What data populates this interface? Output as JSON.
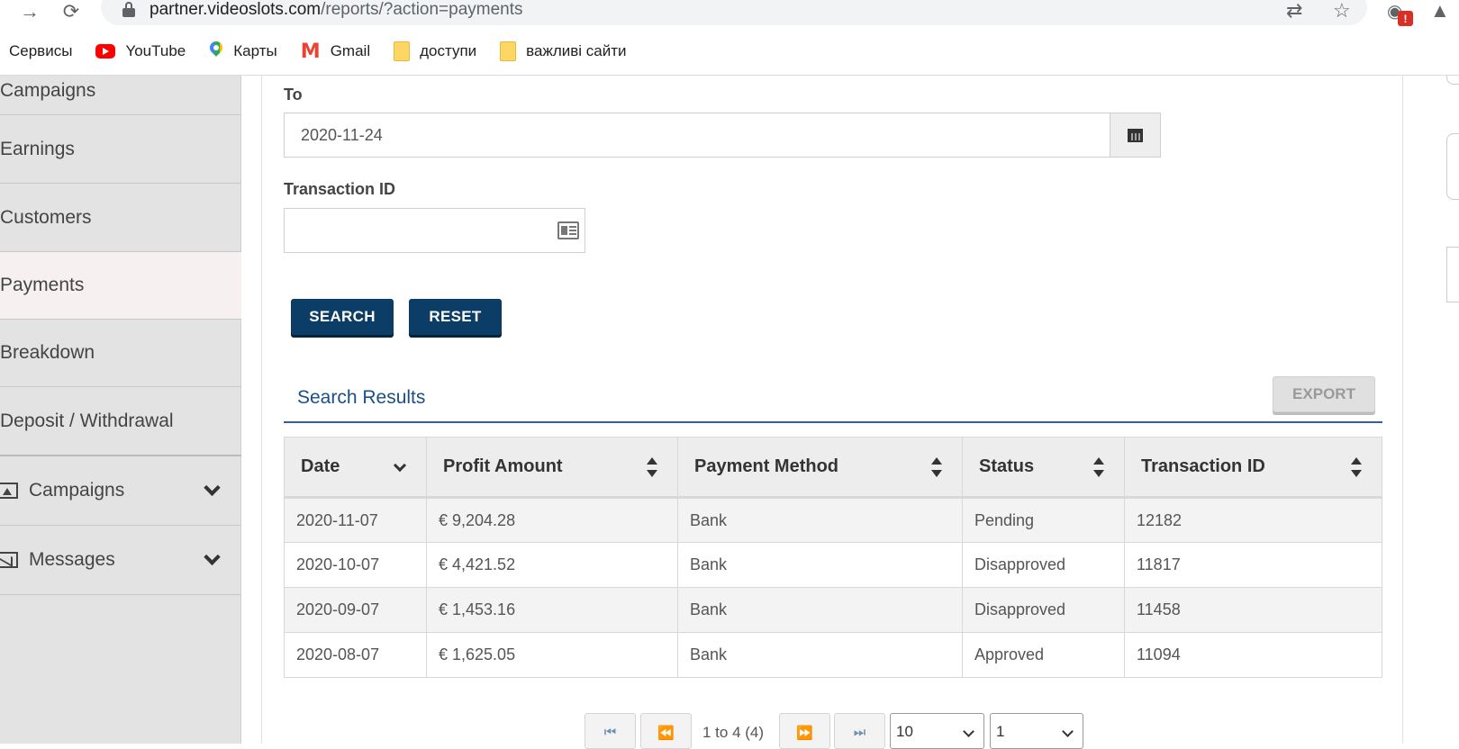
{
  "browser": {
    "url_host": "partner.videoslots.com",
    "url_path": "/reports/?action=payments",
    "bookmarks": [
      {
        "label": "Сервисы",
        "icon": "apps-icon"
      },
      {
        "label": "YouTube",
        "icon": "youtube-icon"
      },
      {
        "label": "Карты",
        "icon": "maps-icon"
      },
      {
        "label": "Gmail",
        "icon": "gmail-icon"
      },
      {
        "label": "доступи",
        "icon": "folder-icon"
      },
      {
        "label": "важливі сайти",
        "icon": "folder-icon"
      }
    ],
    "extension_badge": "!"
  },
  "sidebar": {
    "items": [
      {
        "label": "Campaigns"
      },
      {
        "label": "Earnings"
      },
      {
        "label": "Customers"
      },
      {
        "label": "Payments",
        "active": true
      },
      {
        "label": "Breakdown"
      },
      {
        "label": "Deposit / Withdrawal"
      }
    ],
    "groups": [
      {
        "label": "Campaigns",
        "icon": "image-icon"
      },
      {
        "label": "Messages",
        "icon": "mail-icon"
      }
    ]
  },
  "filters": {
    "to_label": "To",
    "to_value": "2020-11-24",
    "transaction_id_label": "Transaction ID",
    "transaction_id_value": "",
    "search_label": "SEARCH",
    "reset_label": "RESET"
  },
  "results": {
    "title": "Search Results",
    "export_label": "EXPORT",
    "columns": [
      "Date",
      "Profit Amount",
      "Payment Method",
      "Status",
      "Transaction ID"
    ],
    "rows": [
      {
        "date": "2020-11-07",
        "amount": "€ 9,204.28",
        "method": "Bank",
        "status": "Pending",
        "txn": "12182"
      },
      {
        "date": "2020-10-07",
        "amount": "€ 4,421.52",
        "method": "Bank",
        "status": "Disapproved",
        "txn": "11817"
      },
      {
        "date": "2020-09-07",
        "amount": "€ 1,453.16",
        "method": "Bank",
        "status": "Disapproved",
        "txn": "11458"
      },
      {
        "date": "2020-08-07",
        "amount": "€ 1,625.05",
        "method": "Bank",
        "status": "Approved",
        "txn": "11094"
      }
    ]
  },
  "pagination": {
    "info": "1 to 4 (4)",
    "page_size": "10",
    "page": "1"
  },
  "colors": {
    "primary_button": "#0c3d66",
    "results_title": "#1b4f86",
    "sidebar_bg": "#e3e3e3",
    "active_item_bg": "#f6f0f0"
  }
}
